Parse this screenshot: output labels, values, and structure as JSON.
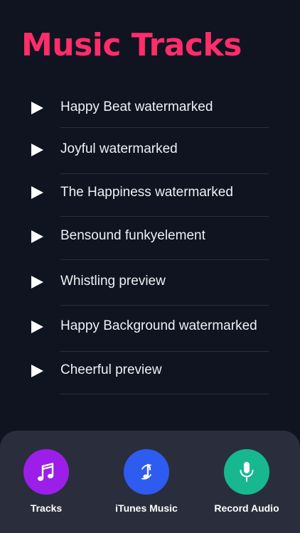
{
  "header": {
    "title": "Music Tracks"
  },
  "tracks": [
    {
      "label": "Happy Beat watermarked"
    },
    {
      "label": "Joyful watermarked"
    },
    {
      "label": "The Happiness watermarked"
    },
    {
      "label": "Bensound funkyelement"
    },
    {
      "label": "Whistling preview"
    },
    {
      "label": "Happy Background watermarked"
    },
    {
      "label": "Cheerful preview"
    }
  ],
  "tabbar": {
    "tracks": {
      "label": "Tracks",
      "icon": "music-note-icon",
      "color": "#9b1fe8"
    },
    "itunes": {
      "label": "iTunes Music",
      "icon": "itunes-note-icon",
      "color": "#2e5bf0"
    },
    "record": {
      "label": "Record Audio",
      "icon": "microphone-icon",
      "color": "#17b890"
    }
  },
  "colors": {
    "background": "#101420",
    "accent": "#ff2d6a",
    "tabbar": "#2a2e3c"
  }
}
